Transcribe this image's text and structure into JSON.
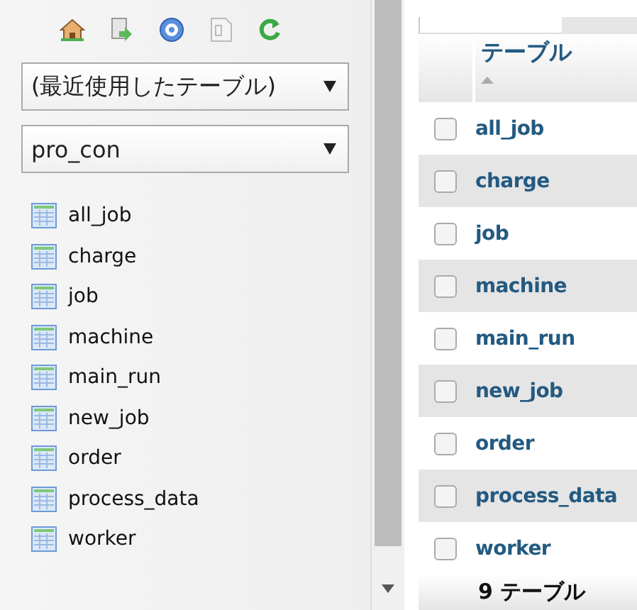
{
  "navigation": {
    "recent_select": {
      "value": "(最近使用したテーブル)"
    },
    "database_select": {
      "value": "pro_con"
    },
    "tables": [
      {
        "name": "all_job"
      },
      {
        "name": "charge"
      },
      {
        "name": "job"
      },
      {
        "name": "machine"
      },
      {
        "name": "main_run"
      },
      {
        "name": "new_job"
      },
      {
        "name": "order"
      },
      {
        "name": "process_data"
      },
      {
        "name": "worker"
      }
    ]
  },
  "table_list": {
    "column": "テーブル",
    "rows": [
      {
        "name": "all_job",
        "checked": false
      },
      {
        "name": "charge",
        "checked": false
      },
      {
        "name": "job",
        "checked": false
      },
      {
        "name": "machine",
        "checked": false
      },
      {
        "name": "main_run",
        "checked": false
      },
      {
        "name": "new_job",
        "checked": false
      },
      {
        "name": "order",
        "checked": false
      },
      {
        "name": "process_data",
        "checked": false
      },
      {
        "name": "worker",
        "checked": false
      }
    ],
    "footer": "9 テーブル"
  }
}
